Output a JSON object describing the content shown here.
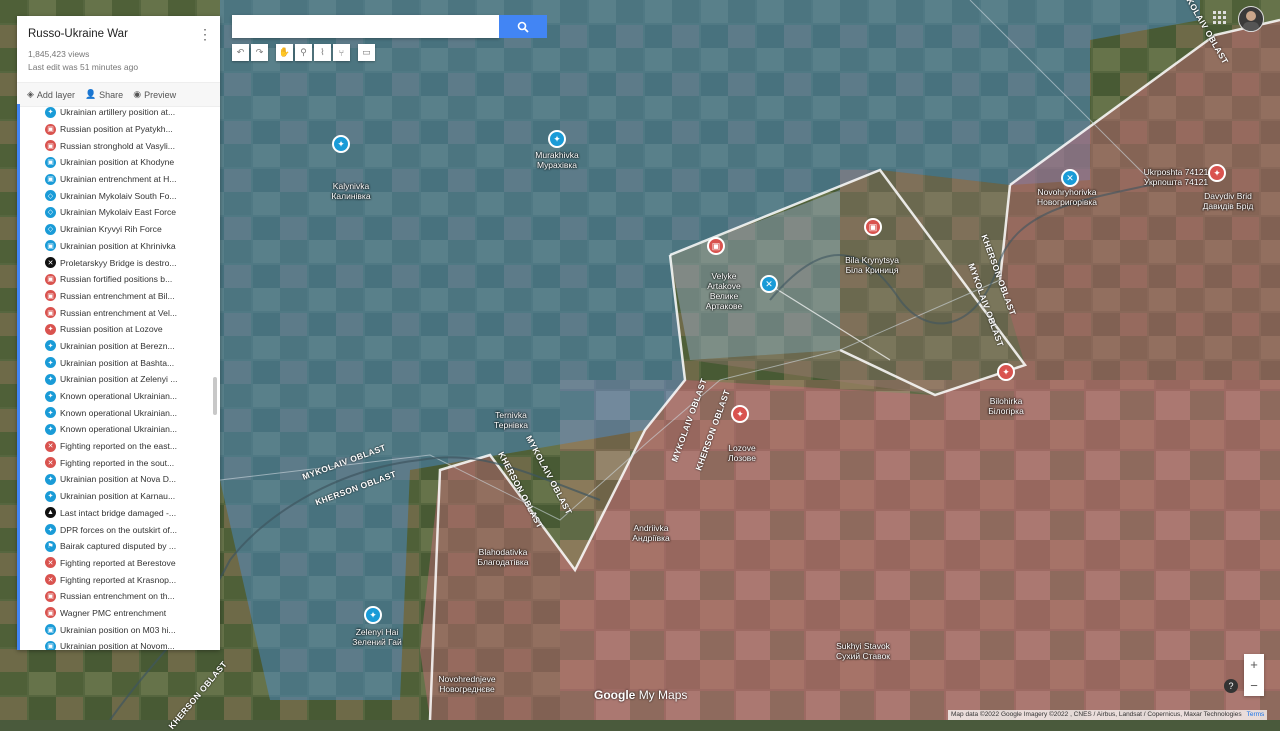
{
  "map": {
    "title": "Russo-Ukraine War",
    "views": "1,845,423 views",
    "last_edit": "Last edit was 51 minutes ago",
    "search_placeholder": "",
    "actions": {
      "add_layer": "Add layer",
      "share": "Share",
      "preview": "Preview"
    }
  },
  "layers": [
    {
      "label": "Ukrainian artillery position at...",
      "color": "#1a9bd7",
      "icon": "artillery-icon"
    },
    {
      "label": "Russian position at Pyatykh...",
      "color": "#d9534f",
      "icon": "fort-icon"
    },
    {
      "label": "Russian stronghold at Vasyli...",
      "color": "#d9534f",
      "icon": "fort-icon"
    },
    {
      "label": "Ukrainian position at Khodyne",
      "color": "#1a9bd7",
      "icon": "fort-icon"
    },
    {
      "label": "Ukrainian entrenchment at H...",
      "color": "#1a9bd7",
      "icon": "fort-icon"
    },
    {
      "label": "Ukrainian Mykolaiv South Fo...",
      "color": "#1a9bd7",
      "icon": "polygon-icon"
    },
    {
      "label": "Ukrainian Mykolaiv East Force",
      "color": "#1a9bd7",
      "icon": "polygon-icon"
    },
    {
      "label": "Ukrainian Kryvyi Rih Force",
      "color": "#1a9bd7",
      "icon": "polygon-icon"
    },
    {
      "label": "Ukrainian position at Khrinivka",
      "color": "#1a9bd7",
      "icon": "fort-icon"
    },
    {
      "label": "Proletarskyy Bridge is destro...",
      "color": "#111111",
      "icon": "cross-icon"
    },
    {
      "label": "Russian fortified positions b...",
      "color": "#d9534f",
      "icon": "fort-icon"
    },
    {
      "label": "Russian entrenchment at Bil...",
      "color": "#d9534f",
      "icon": "fort-icon"
    },
    {
      "label": "Russian entrenchment at Vel...",
      "color": "#d9534f",
      "icon": "fort-icon"
    },
    {
      "label": "Russian position at Lozove",
      "color": "#d9534f",
      "icon": "soldier-icon"
    },
    {
      "label": "Ukrainian position at Berezn...",
      "color": "#1a9bd7",
      "icon": "soldier-icon"
    },
    {
      "label": "Ukrainian position at Bashta...",
      "color": "#1a9bd7",
      "icon": "soldier-icon"
    },
    {
      "label": "Ukrainian position at Zelenyi ...",
      "color": "#1a9bd7",
      "icon": "soldier-icon"
    },
    {
      "label": "Known operational Ukrainian...",
      "color": "#1a9bd7",
      "icon": "artillery-icon"
    },
    {
      "label": "Known operational Ukrainian...",
      "color": "#1a9bd7",
      "icon": "artillery-icon"
    },
    {
      "label": "Known operational Ukrainian...",
      "color": "#1a9bd7",
      "icon": "artillery-icon"
    },
    {
      "label": "Fighting reported on the east...",
      "color": "#d9534f",
      "icon": "swords-icon"
    },
    {
      "label": "Fighting reported in the sout...",
      "color": "#d9534f",
      "icon": "swords-icon"
    },
    {
      "label": "Ukrainian position at Nova D...",
      "color": "#1a9bd7",
      "icon": "soldier-icon"
    },
    {
      "label": "Ukrainian position at Karnau...",
      "color": "#1a9bd7",
      "icon": "soldier-icon"
    },
    {
      "label": "Last intact bridge damaged -...",
      "color": "#111111",
      "icon": "warning-icon"
    },
    {
      "label": "DPR forces on the outskirt of...",
      "color": "#1a9bd7",
      "icon": "soldier-icon"
    },
    {
      "label": "Bairak captured disputed by ...",
      "color": "#1a9bd7",
      "icon": "flag-icon"
    },
    {
      "label": "Fighting reported at Berestove",
      "color": "#d9534f",
      "icon": "swords-icon"
    },
    {
      "label": "Fighting reported at Krasnop...",
      "color": "#d9534f",
      "icon": "swords-icon"
    },
    {
      "label": "Russian entrenchment on th...",
      "color": "#d9534f",
      "icon": "fort-icon"
    },
    {
      "label": "Wagner PMC entrenchment",
      "color": "#d9534f",
      "icon": "fort-icon"
    },
    {
      "label": "Ukrainian position on M03 hi...",
      "color": "#1a9bd7",
      "icon": "fort-icon"
    },
    {
      "label": "Ukrainian position at Novom...",
      "color": "#1a9bd7",
      "icon": "fort-icon"
    }
  ],
  "places": [
    {
      "en": "Murakhivka",
      "uk": "Мурахівка"
    },
    {
      "en": "Kalynivka",
      "uk": "Калинівка"
    },
    {
      "en": "Velyke Artakove",
      "uk": "Велике Артакове"
    },
    {
      "en": "Bila Krynytsya",
      "uk": "Біла Криниця"
    },
    {
      "en": "Novohryhorivka",
      "uk": "Новогригорівка"
    },
    {
      "en": "Ukrposhta 74121",
      "uk": "Укрпошта 74121"
    },
    {
      "en": "Davydiv Brid",
      "uk": "Давидів Брід"
    },
    {
      "en": "Bilohirka",
      "uk": "Білогірка"
    },
    {
      "en": "Ternivka",
      "uk": "Тернівка"
    },
    {
      "en": "Lozove",
      "uk": "Лозове"
    },
    {
      "en": "Andriivka",
      "uk": "Андріївка"
    },
    {
      "en": "Blahodativka",
      "uk": "Благодатівка"
    },
    {
      "en": "Zelenyi Hai",
      "uk": "Зелений Гай"
    },
    {
      "en": "Sukhyi Stavok",
      "uk": "Сухий Ставок"
    },
    {
      "en": "Novohrednjeve",
      "uk": "Новогреднєве"
    }
  ],
  "oblast_labels": {
    "mykolaiv": "MYKOLAIV OBLAST",
    "kherson": "KHERSON OBLAST"
  },
  "colors": {
    "ukraine_zone": "#4a90d9",
    "russia_zone": "#c86a7a",
    "ukr_marker": "#1a9bd7",
    "rus_marker": "#d9534f"
  },
  "footer": {
    "attribution": "Map data ©2022 Google Imagery ©2022 , CNES / Airbus, Landsat / Copernicus, Maxar Technologies",
    "terms": "Terms",
    "logo_google": "Google",
    "logo_mymaps": "My Maps"
  }
}
